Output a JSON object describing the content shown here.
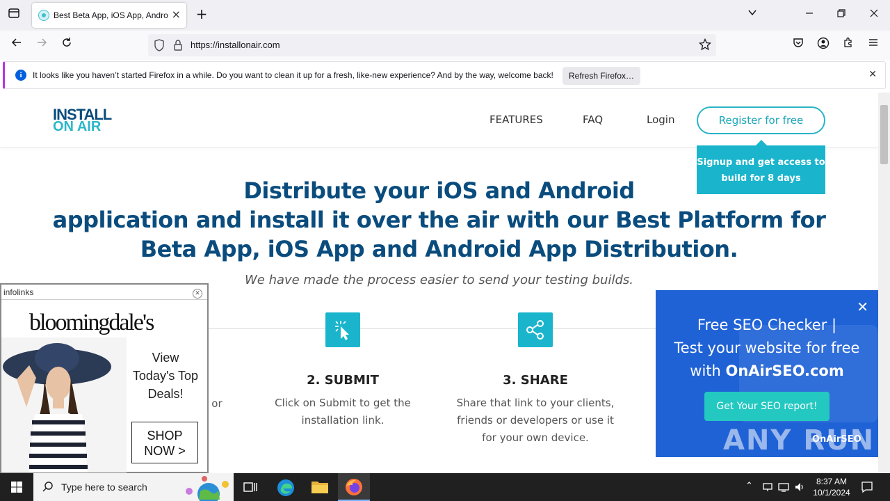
{
  "browser": {
    "tab_title": "Best Beta App, iOS App, Android",
    "url": "https://installonair.com",
    "infobar_message": "It looks like you haven’t started Firefox in a while. Do you want to clean it up for a fresh, like-new experience? And by the way, welcome back!",
    "infobar_button": "Refresh Firefox…"
  },
  "site": {
    "logo_line1": "INSTALL",
    "logo_line2": "ON AIR",
    "nav": [
      "FEATURES",
      "FAQ",
      "Login"
    ],
    "register_label": "Register for free",
    "signup_tip": "Signup and get access to build for 8 days",
    "hero_line1": "Distribute your iOS and Android",
    "hero_line2": "application and install it over the air with our Best Platform for",
    "hero_line3": "Beta App, iOS App and Android App Distribution.",
    "subline": "We have made the process easier to send your testing builds.",
    "steps": [
      {
        "title": "2. SUBMIT",
        "desc": "Click on Submit to get the installation link."
      },
      {
        "title": "3. SHARE",
        "desc": "Share that link to your clients, friends or developers or use it for your own device."
      }
    ],
    "partial_step_text": "S or"
  },
  "infolinks_ad": {
    "brand": "infolinks",
    "advertiser": "bloomingdale's",
    "text": "View Today's Top Deals!",
    "button": "SHOP NOW >"
  },
  "seo_ad": {
    "line1": "Free SEO Checker |",
    "line2": "Test your website for free",
    "line3_prefix": "with ",
    "line3_brand": "OnAirSEO.com",
    "cta": "Get Your SEO report!",
    "logo": "OnAirSEO"
  },
  "watermark": "ANY RUN",
  "taskbar": {
    "search_placeholder": "Type here to search",
    "time": "8:37 AM",
    "date": "10/1/2024"
  },
  "colors": {
    "brand_dark": "#0a4c7d",
    "brand_teal": "#1ab5cc",
    "seo_blue": "#1f62d6"
  }
}
